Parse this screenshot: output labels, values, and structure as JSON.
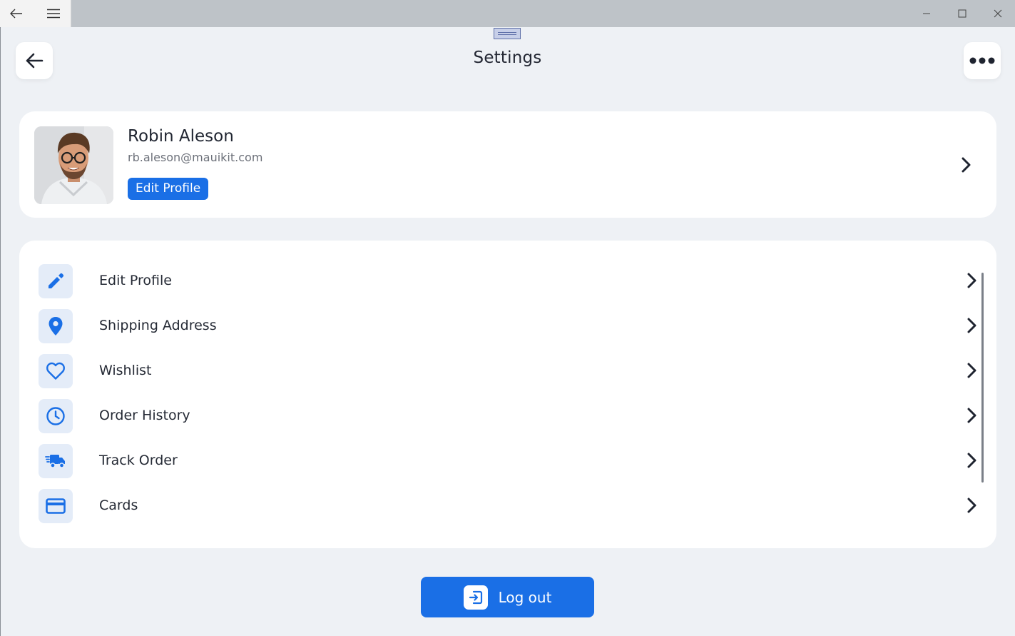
{
  "window": {
    "back_icon": "arrow-left-icon",
    "menu_icon": "hamburger-icon",
    "controls": [
      "minimize-icon",
      "maximize-icon",
      "close-icon"
    ]
  },
  "header": {
    "title": "Settings",
    "back_icon": "arrow-left-icon",
    "more_icon": "more-dots-icon"
  },
  "profile": {
    "name": "Robin Aleson",
    "email": "rb.aleson@mauikit.com",
    "edit_button_label": "Edit Profile",
    "avatar_icon": "avatar-photo"
  },
  "menu": {
    "items": [
      {
        "label": "Edit Profile",
        "icon": "pencil-icon"
      },
      {
        "label": "Shipping Address",
        "icon": "location-pin-icon"
      },
      {
        "label": "Wishlist",
        "icon": "heart-icon"
      },
      {
        "label": "Order History",
        "icon": "clock-icon"
      },
      {
        "label": "Track Order",
        "icon": "truck-icon"
      },
      {
        "label": "Cards",
        "icon": "credit-card-icon"
      }
    ]
  },
  "logout": {
    "label": "Log out",
    "icon": "logout-icon"
  },
  "colors": {
    "accent": "#1a6fe6",
    "background": "#eef1f5",
    "card": "#ffffff",
    "icon_tile": "#e4ecf8"
  }
}
